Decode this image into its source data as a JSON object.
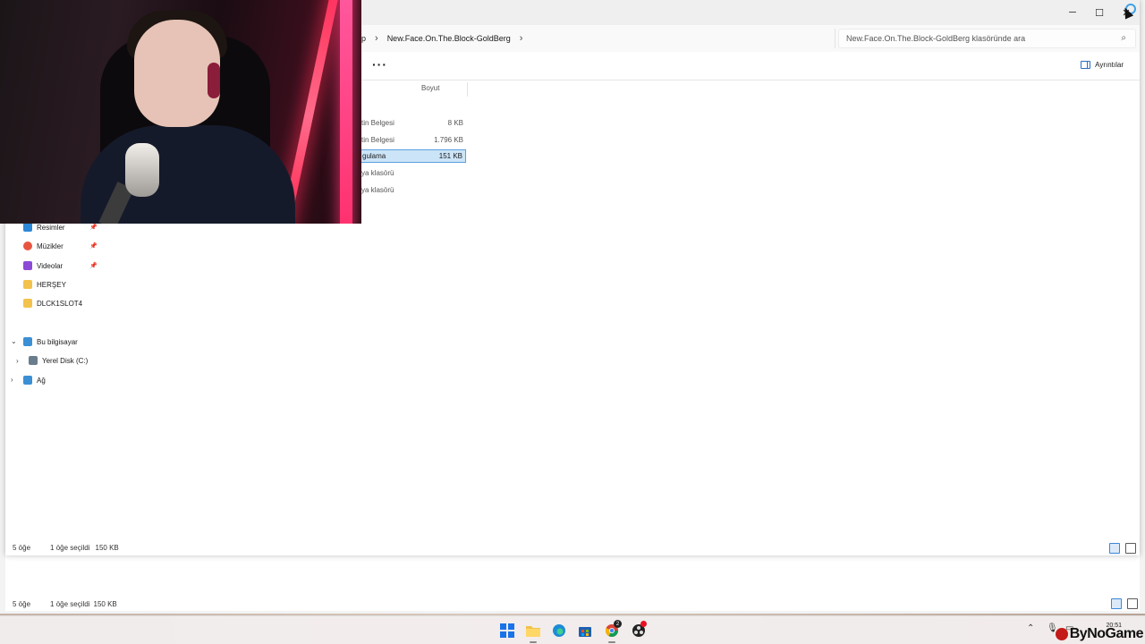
{
  "window": {
    "breadcrumb_prev": "p",
    "breadcrumb_current": "New.Face.On.The.Block-GoldBerg",
    "search_placeholder": "New.Face.On.The.Block-GoldBerg klasöründe ara",
    "more_label": "···",
    "details_label": "Ayrıntılar",
    "minimize": "─",
    "maximize": "☐",
    "close": "✕"
  },
  "columns": {
    "size": "Boyut"
  },
  "files": [
    {
      "type": "tin Belgesi",
      "size": "8 KB"
    },
    {
      "type": "tin Belgesi",
      "size": "1.796 KB"
    },
    {
      "type": "gulama",
      "size": "151 KB",
      "selected": true
    },
    {
      "type": "ya klasörü",
      "size": ""
    },
    {
      "type": "ya klasörü",
      "size": ""
    }
  ],
  "nav": {
    "quick_access": [
      {
        "label": "Resimler",
        "icon": "pictures-icon",
        "color": "#2b88d8"
      },
      {
        "label": "Müzikler",
        "icon": "music-icon",
        "color": "#e8553f"
      },
      {
        "label": "Videolar",
        "icon": "videos-icon",
        "color": "#8c4bd6"
      },
      {
        "label": "HERŞEY",
        "icon": "folder-icon",
        "color": "#f2c24c"
      },
      {
        "label": "DLCK1SLOT4",
        "icon": "folder-icon",
        "color": "#f2c24c"
      }
    ],
    "this_pc": "Bu bilgisayar",
    "local_disk": "Yerel Disk (C:)",
    "network": "Ağ"
  },
  "status": {
    "count": "5 öğe",
    "selection": "1 öğe seçildi",
    "selection_size": "150 KB"
  },
  "back_status": {
    "count": "5 öğe",
    "selection": "1 öğe seçildi",
    "selection_size": "150 KB"
  },
  "taskbar": {
    "clock_time": "20:51",
    "chrome_badge": "2",
    "watermark": "ByNoGame"
  }
}
